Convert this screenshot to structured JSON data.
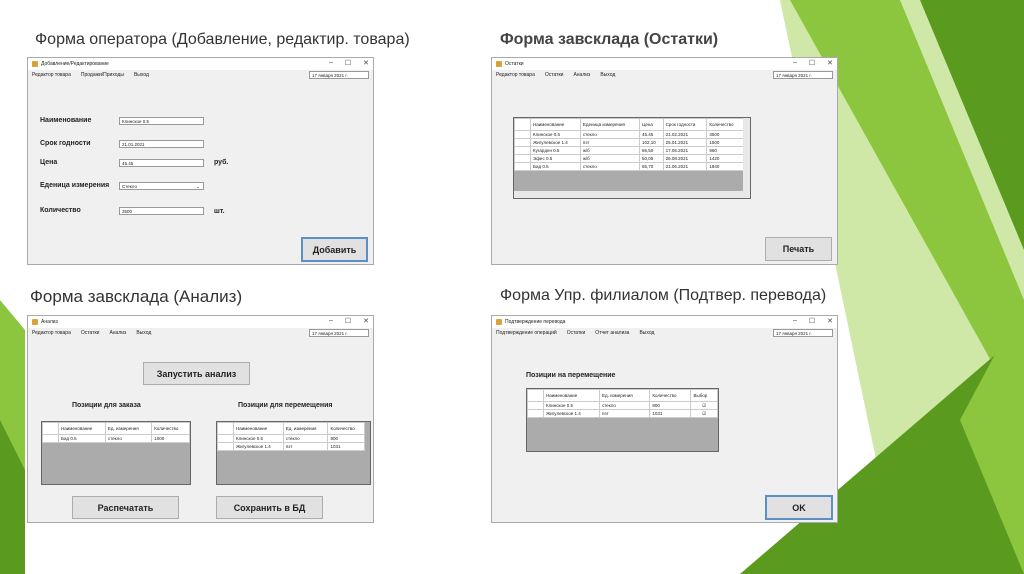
{
  "headings": [
    "Форма оператора (Добавление, редактир. товара)",
    "Форма завсклада (Остатки)",
    "Форма завсклада (Анализ)",
    "Форма Упр. филиалом (Подтвер. перевода)"
  ],
  "colors": {
    "green_dark": "#5a9a1e",
    "green_mid": "#8cc63f",
    "green_light": "#cfe8a8"
  },
  "date": "17  января  2021 г.",
  "form1": {
    "title": "Добавление/Редактирование",
    "menu": [
      "Редактор товара",
      "Продажи/Приходы",
      "Выход"
    ],
    "fields": [
      {
        "label": "Наименование",
        "value": "Клинское 0.5"
      },
      {
        "label": "Срок годности",
        "value": "21.01.2021"
      },
      {
        "label": "Цена",
        "value": "45.45",
        "unit": "руб."
      },
      {
        "label": "Еденица измерения",
        "value": "Стекло"
      },
      {
        "label": "Количество",
        "value": "3500",
        "unit": "шт."
      }
    ],
    "button": "Добавить"
  },
  "form2": {
    "title": "Остатки",
    "menu": [
      "Редактор товара",
      "Остатки",
      "Анализ",
      "Выход"
    ],
    "columns": [
      "Наименование",
      "Еденица измерения",
      "Цена",
      "Срок годности",
      "Количество"
    ],
    "rows": [
      [
        "Клинское 0.5",
        "стекло",
        "45.45",
        "21.02.2021",
        "3500"
      ],
      [
        "Жигулевское 1.4",
        "пэт",
        "102,10",
        "25.01.2021",
        "1500"
      ],
      [
        "Кугарден 0.5",
        "ж/б",
        "86,50",
        "17.05.2021",
        "960"
      ],
      [
        "Эфес 0.5",
        "ж/б",
        "50,05",
        "26.08.2021",
        "1420"
      ],
      [
        "Бад 0.5",
        "стекло",
        "65,70",
        "21.06.2021",
        "1840"
      ]
    ],
    "button": "Печать"
  },
  "form3": {
    "title": "Анализ",
    "menu": [
      "Редактор товара",
      "Остатки",
      "Анализ",
      "Выход"
    ],
    "run_button": "Запустить анализ",
    "order_label": "Позиции для заказа",
    "move_label": "Позиции для перемещения",
    "columns": [
      "Наименование",
      "Ед. измерения",
      "Количество"
    ],
    "order_rows": [
      [
        "Бад 0.5",
        "стекло",
        "1000"
      ]
    ],
    "move_rows": [
      [
        "Клинское 0.5",
        "стекло",
        "800"
      ],
      [
        "Жигулевское 1.4",
        "пэт",
        "1031"
      ]
    ],
    "print_button": "Распечатать",
    "save_button": "Сохранить в БД"
  },
  "form4": {
    "title": "Подтверждение перевода",
    "menu": [
      "Подтверждение операций",
      "Остатки",
      "Отчет анализа",
      "Выход"
    ],
    "label": "Позиции на перемещение",
    "columns": [
      "Наименование",
      "Ед. измерения",
      "Количество",
      "Выбор"
    ],
    "rows": [
      [
        "Клинское 0.5",
        "стекло",
        "800"
      ],
      [
        "Жигулевское 1.4",
        "пэт",
        "1031"
      ]
    ],
    "button": "OK"
  }
}
